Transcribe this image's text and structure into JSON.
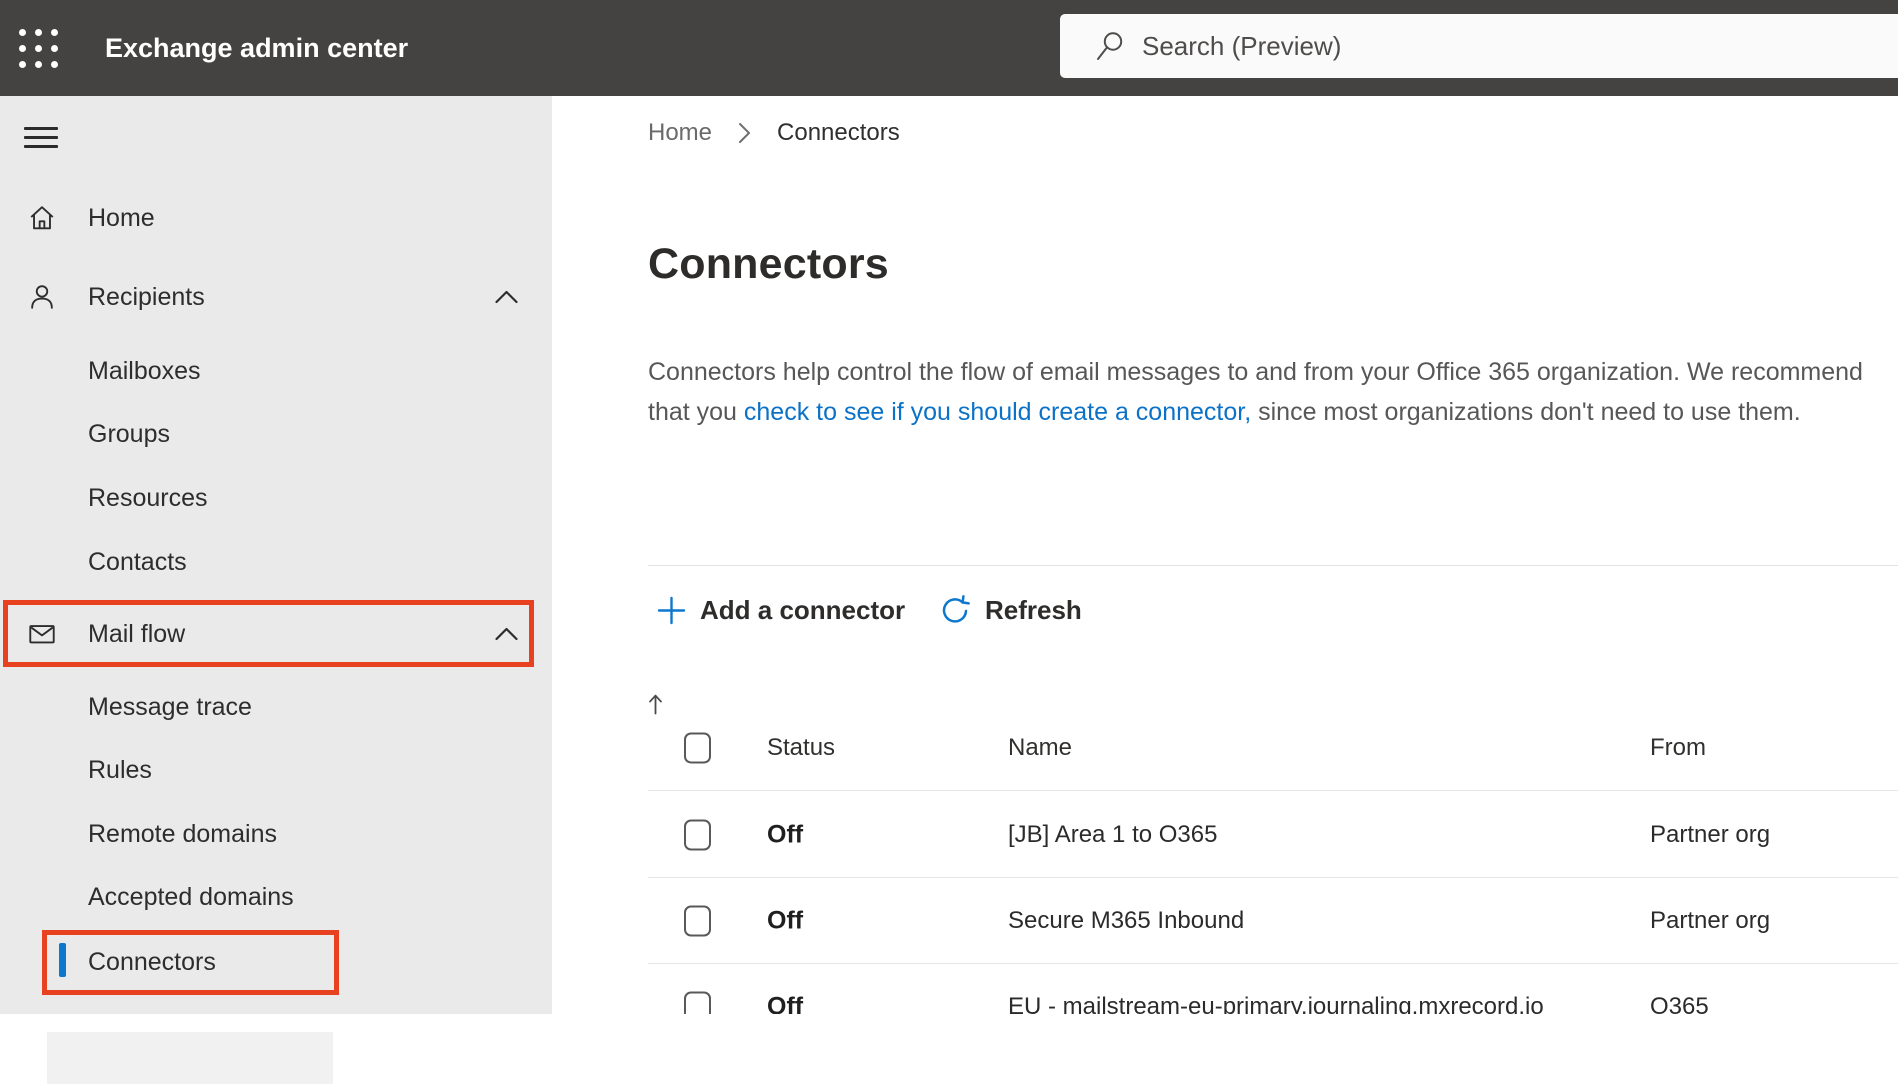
{
  "app": {
    "title": "Exchange admin center",
    "search_placeholder": "Search (Preview)"
  },
  "colors": {
    "topbar_bg": "#454341",
    "sidebar_bg": "#eaeaea",
    "accent_blue": "#0d78cd",
    "link_blue": "#0b72c7",
    "annotation_red": "#e8411f",
    "main_bg": "#ffffff",
    "text_dark": "#2d2d2d",
    "text_gray": "#575757"
  },
  "sidebar": {
    "items": [
      {
        "label": "Home",
        "icon": "home-icon",
        "level": 0
      },
      {
        "label": "Recipients",
        "icon": "person-icon",
        "level": 0,
        "expanded": true
      },
      {
        "label": "Mailboxes",
        "level": 1
      },
      {
        "label": "Groups",
        "level": 1
      },
      {
        "label": "Resources",
        "level": 1
      },
      {
        "label": "Contacts",
        "level": 1
      },
      {
        "label": "Mail flow",
        "icon": "mail-icon",
        "level": 0,
        "expanded": true,
        "annotated": true
      },
      {
        "label": "Message trace",
        "level": 1
      },
      {
        "label": "Rules",
        "level": 1
      },
      {
        "label": "Remote domains",
        "level": 1
      },
      {
        "label": "Accepted domains",
        "level": 1
      },
      {
        "label": "Connectors",
        "level": 1,
        "selected": true,
        "annotated": true
      }
    ]
  },
  "breadcrumb": {
    "home": "Home",
    "current": "Connectors"
  },
  "page": {
    "title": "Connectors",
    "intro_before_link": "Connectors help control the flow of email messages to and from your Office 365 organization. We recommend that you ",
    "intro_link": "check to see if you should create a connector,",
    "intro_after_link": " since most organizations don't need to use them."
  },
  "toolbar": {
    "add_connector_label": "Add a connector",
    "refresh_label": "Refresh"
  },
  "table": {
    "headers": {
      "status": "Status",
      "name": "Name",
      "from": "From"
    },
    "sort": {
      "column": "Status",
      "direction": "ascending"
    },
    "rows": [
      {
        "status": "Off",
        "name": "[JB] Area 1 to O365",
        "from": "Partner org"
      },
      {
        "status": "Off",
        "name": "Secure M365 Inbound",
        "from": "Partner org"
      },
      {
        "status": "Off",
        "name": "EU - mailstream-eu-primary.journaling.mxrecord.io",
        "from": "O365"
      }
    ]
  }
}
